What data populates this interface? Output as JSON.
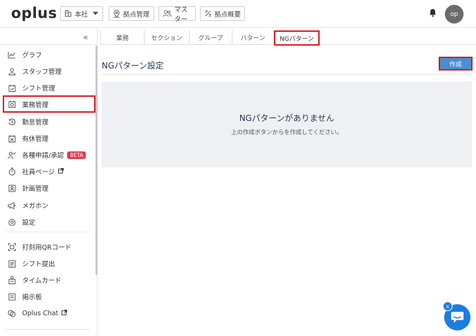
{
  "header": {
    "logo": "oplus",
    "branch_label": "本社",
    "buttons": [
      {
        "label": "拠点管理"
      },
      {
        "label": "マスター"
      },
      {
        "label": "拠点概要"
      }
    ],
    "avatar_initials": "op"
  },
  "sidebar": {
    "collapse_glyph": "«",
    "items": [
      {
        "label": "グラフ"
      },
      {
        "label": "スタッフ管理"
      },
      {
        "label": "シフト管理"
      },
      {
        "label": "業務管理"
      },
      {
        "label": "勤怠管理"
      },
      {
        "label": "有休管理"
      },
      {
        "label": "各種申請/承認",
        "badge": "BETA"
      },
      {
        "label": "社員ページ"
      },
      {
        "label": "計画管理"
      },
      {
        "label": "メガホン"
      },
      {
        "label": "設定"
      },
      {
        "label": "打刻用QRコード"
      },
      {
        "label": "シフト提出"
      },
      {
        "label": "タイムカード"
      },
      {
        "label": "掲示板"
      },
      {
        "label": "Oplus Chat"
      }
    ]
  },
  "tabs": [
    {
      "label": "業務"
    },
    {
      "label": "セクション"
    },
    {
      "label": "グループ"
    },
    {
      "label": "パターン"
    },
    {
      "label": "NGパターン"
    }
  ],
  "main": {
    "section_title": "NGパターン設定",
    "create_button": "作成",
    "empty_title": "NGパターンがありません",
    "empty_desc": "上の作成ボタンからを作成してください。"
  },
  "chat": {
    "close_glyph": "×"
  },
  "colors": {
    "highlight": "#d41d27",
    "primary_button": "#4a8fd0",
    "beta_badge": "#e23a52",
    "chat_widget": "#1c7de0"
  }
}
